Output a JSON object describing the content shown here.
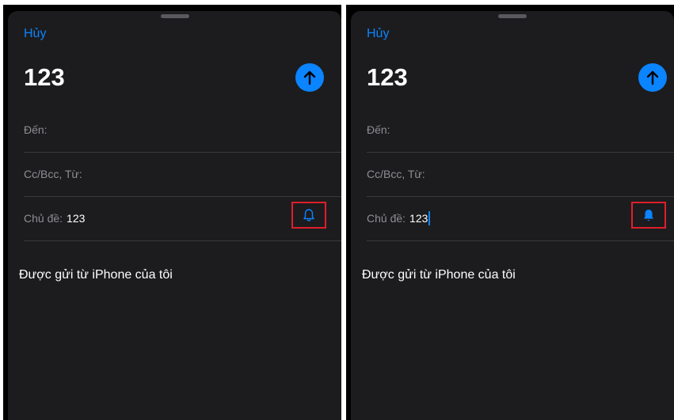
{
  "colors": {
    "accent": "#0a84ff",
    "background": "#1c1c1e",
    "highlight_box": "#e01e2a"
  },
  "panels": [
    {
      "cancel_label": "Hủy",
      "subject_title": "123",
      "send_icon": "arrow-up-icon",
      "to_label": "Đến:",
      "cc_label": "Cc/Bcc, Từ:",
      "subject_label": "Chủ đề:",
      "subject_value": "123",
      "bell_icon": "bell-outline-icon",
      "body_text": "Được gửi từ iPhone của tôi"
    },
    {
      "cancel_label": "Hủy",
      "subject_title": "123",
      "send_icon": "arrow-up-icon",
      "to_label": "Đến:",
      "cc_label": "Cc/Bcc, Từ:",
      "subject_label": "Chủ đề:",
      "subject_value": "123",
      "bell_icon": "bell-filled-icon",
      "body_text": "Được gửi từ iPhone của tôi"
    }
  ]
}
